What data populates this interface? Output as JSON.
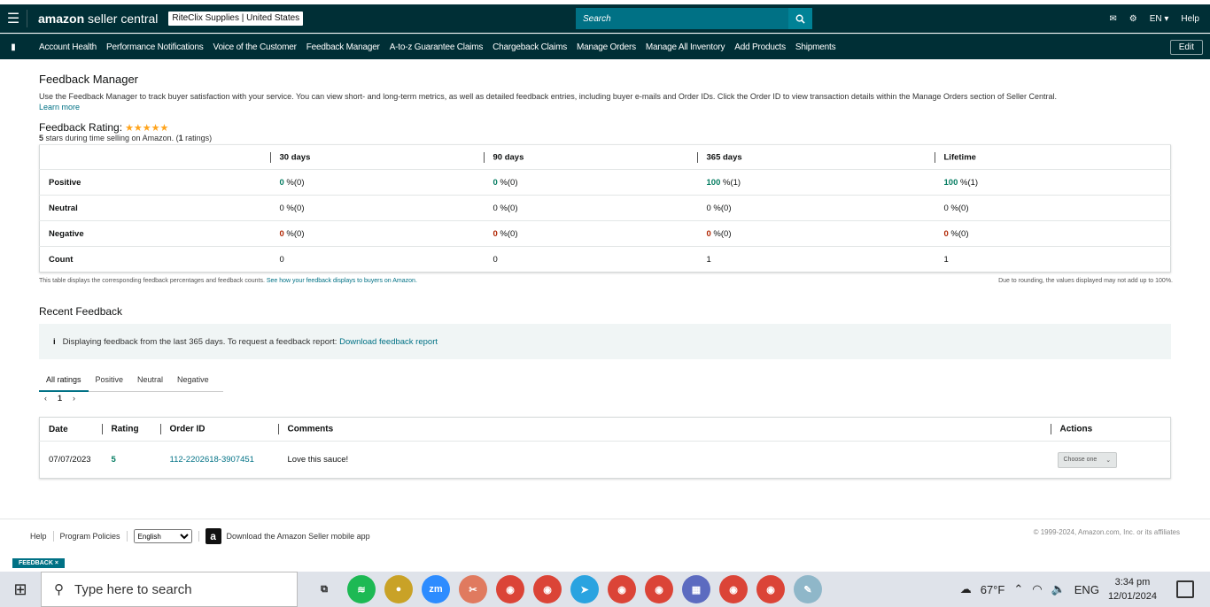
{
  "header": {
    "logo_amazon": "amazon",
    "logo_rest": " seller central",
    "account": "RiteClix Supplies | United States",
    "search_placeholder": "Search",
    "lang": "EN",
    "help": "Help"
  },
  "nav": {
    "items": [
      "Account Health",
      "Performance Notifications",
      "Voice of the Customer",
      "Feedback Manager",
      "A-to-z Guarantee Claims",
      "Chargeback Claims",
      "Manage Orders",
      "Manage All Inventory",
      "Add Products",
      "Shipments"
    ],
    "edit": "Edit"
  },
  "page": {
    "title": "Feedback Manager",
    "description": "Use the Feedback Manager to track buyer satisfaction with your service. You can view short- and long-term metrics, as well as detailed feedback entries, including buyer e-mails and Order IDs. Click the Order ID to view transaction details within the Manage Orders section of Seller Central.",
    "learn_more": "Learn more",
    "rating_label": "Feedback Rating:",
    "stars": "★★★★★",
    "rating_stars_count": "5",
    "rating_text_a": " stars during time selling on Amazon. (",
    "rating_count": "1",
    "rating_text_b": " ratings)"
  },
  "summary": {
    "headers": [
      "30 days",
      "90 days",
      "365 days",
      "Lifetime"
    ],
    "rows": [
      {
        "label": "Positive",
        "cells": [
          [
            "0",
            " %(0)"
          ],
          [
            "0",
            " %(0)"
          ],
          [
            "100",
            " %(1)"
          ],
          [
            "100",
            " %(1)"
          ]
        ],
        "color": "g"
      },
      {
        "label": "Neutral",
        "cells": [
          [
            "0",
            " %(0)"
          ],
          [
            "0",
            " %(0)"
          ],
          [
            "0",
            " %(0)"
          ],
          [
            "0",
            " %(0)"
          ]
        ],
        "color": ""
      },
      {
        "label": "Negative",
        "cells": [
          [
            "0",
            " %(0)"
          ],
          [
            "0",
            " %(0)"
          ],
          [
            "0",
            " %(0)"
          ],
          [
            "0",
            " %(0)"
          ]
        ],
        "color": "r"
      },
      {
        "label": "Count",
        "cells": [
          [
            "",
            "0"
          ],
          [
            "",
            "0"
          ],
          [
            "",
            "1"
          ],
          [
            "",
            "1"
          ]
        ],
        "color": ""
      }
    ],
    "note_left": "This table displays the corresponding feedback percentages and feedback counts.",
    "note_link": "See how your feedback displays to buyers on Amazon.",
    "note_right": "Due to rounding, the values displayed may not add up to 100%."
  },
  "recent": {
    "title": "Recent Feedback",
    "info_text": "Displaying feedback from the last 365 days. To request a feedback report:",
    "info_link": "Download feedback report",
    "tabs": [
      "All ratings",
      "Positive",
      "Neutral",
      "Negative"
    ],
    "page": "1",
    "headers": [
      "Date",
      "Rating",
      "Order ID",
      "Comments",
      "Actions"
    ],
    "rows": [
      {
        "date": "07/07/2023",
        "rating": "5",
        "order_id": "112-2202618-3907451",
        "comment": "Love this sauce!",
        "action": "Choose one"
      }
    ]
  },
  "footer": {
    "help": "Help",
    "policies": "Program Policies",
    "language": "English",
    "app_text": "Download the Amazon Seller mobile app",
    "copyright": "© 1999-2024, Amazon.com, Inc. or its affiliates",
    "feedback_tag": "FEEDBACK ×"
  },
  "taskbar": {
    "search_placeholder": "Type here to search",
    "temp": "67°F",
    "lang": "ENG",
    "time": "3:34 pm",
    "date": "12/01/2024",
    "colors": {
      "spotify": "#1db954",
      "zoom": "#2d8cff",
      "telegram": "#2aa3e0",
      "chrome": "#db4437"
    }
  }
}
